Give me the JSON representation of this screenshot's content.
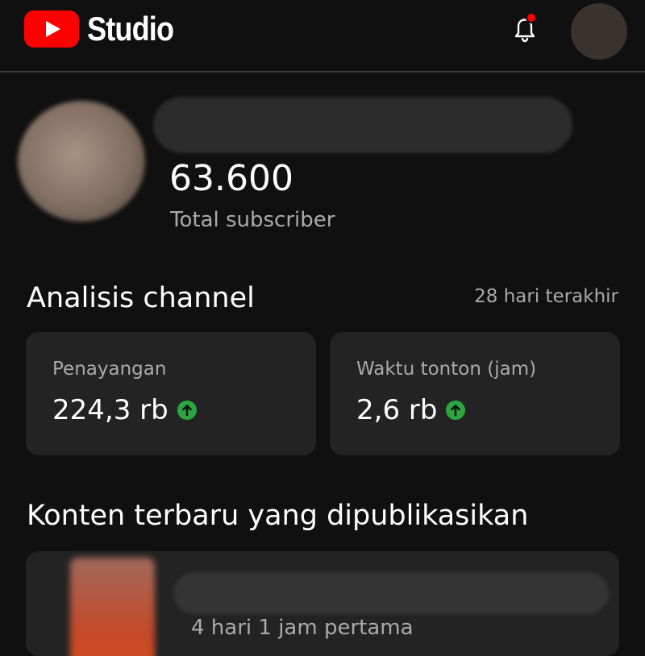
{
  "header": {
    "app_name": "Studio",
    "logo_icon": "youtube-play-icon",
    "notification_icon": "bell-icon",
    "notification_dot_color": "#ff0000",
    "brand_color": "#ff0000"
  },
  "channel": {
    "subscriber_count": "63.600",
    "subscriber_label": "Total subscriber"
  },
  "analytics": {
    "title": "Analisis channel",
    "period": "28 hari terakhir",
    "trend_color": "#2ba640",
    "cards": [
      {
        "label": "Penayangan",
        "value": "224,3 rb",
        "trend_icon": "arrow-up-icon"
      },
      {
        "label": "Waktu tonton (jam)",
        "value": "2,6 rb",
        "trend_icon": "arrow-up-icon"
      }
    ]
  },
  "latest_content": {
    "title": "Konten terbaru yang dipublikasikan",
    "item": {
      "stat_period": "4 hari 1 jam pertama"
    }
  }
}
